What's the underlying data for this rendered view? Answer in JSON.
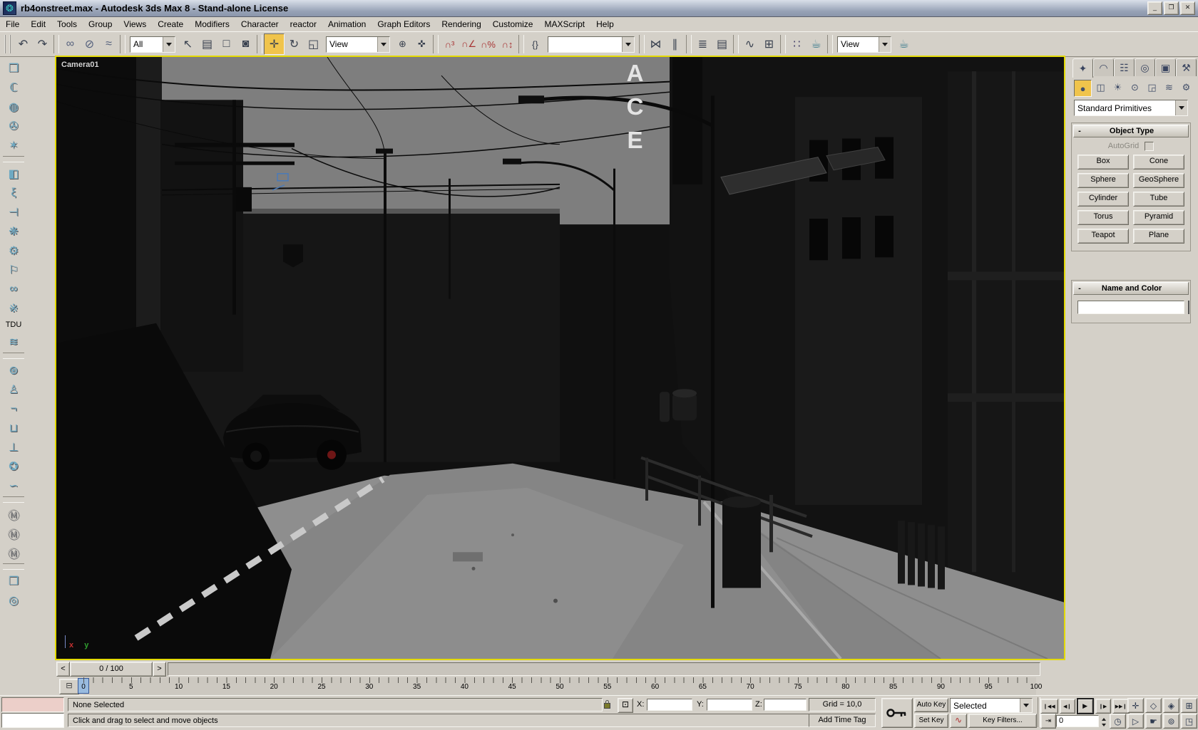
{
  "window": {
    "title": "rb4onstreet.max - Autodesk 3ds Max 8  - Stand-alone License",
    "icon_glyph": "❂",
    "controls": [
      {
        "name": "minimize-button",
        "glyph": "_"
      },
      {
        "name": "maximize-button",
        "glyph": "❐"
      },
      {
        "name": "close-button",
        "glyph": "✕"
      }
    ]
  },
  "menu": {
    "items": [
      "File",
      "Edit",
      "Tools",
      "Group",
      "Views",
      "Create",
      "Modifiers",
      "Character",
      "reactor",
      "Animation",
      "Graph Editors",
      "Rendering",
      "Customize",
      "MAXScript",
      "Help"
    ]
  },
  "toolbar": {
    "seg1": [
      {
        "name": "undo-icon",
        "glyph": "↶"
      },
      {
        "name": "redo-icon",
        "glyph": "↷"
      },
      {
        "kind": "divider"
      },
      {
        "name": "select-and-link-icon",
        "glyph": "∞",
        "color": "#55617d"
      },
      {
        "name": "unlink-selection-icon",
        "glyph": "⊘",
        "color": "#55617d"
      },
      {
        "name": "bind-to-space-warp-icon",
        "glyph": "≈",
        "color": "#55617d"
      },
      {
        "kind": "divider"
      }
    ],
    "selection_filter": {
      "value": "All"
    },
    "seg2": [
      {
        "name": "select-object-icon",
        "glyph": "↖"
      },
      {
        "name": "select-by-name-icon",
        "glyph": "▤"
      },
      {
        "name": "rectangular-selection-region-icon",
        "glyph": "□"
      },
      {
        "name": "window-crossing-toggle-icon",
        "glyph": "◙"
      },
      {
        "kind": "divider"
      },
      {
        "name": "select-and-move-icon",
        "glyph": "✛",
        "active": true
      },
      {
        "name": "select-and-rotate-icon",
        "glyph": "↻"
      },
      {
        "name": "select-and-scale-icon",
        "glyph": "◱"
      }
    ],
    "reference_coordinate": {
      "value": "View"
    },
    "seg3": [
      {
        "name": "use-pivot-center-icon",
        "glyph": "⊕"
      },
      {
        "name": "select-and-manipulate-icon",
        "glyph": "✜"
      },
      {
        "kind": "divider"
      },
      {
        "name": "snap-toggle-3d-icon",
        "glyph": "∩³",
        "color": "#a83434"
      },
      {
        "name": "angle-snap-icon",
        "glyph": "∩∠",
        "color": "#a83434"
      },
      {
        "name": "percent-snap-icon",
        "glyph": "∩%",
        "color": "#a83434"
      },
      {
        "name": "spinner-snap-icon",
        "glyph": "∩↕",
        "color": "#a83434"
      },
      {
        "kind": "divider"
      },
      {
        "name": "edit-named-selection-sets-icon",
        "glyph": "{}"
      }
    ],
    "named_selection": {
      "value": ""
    },
    "seg4": [
      {
        "kind": "divider"
      },
      {
        "name": "mirror-icon",
        "glyph": "⋈"
      },
      {
        "name": "align-icon",
        "glyph": "∥"
      },
      {
        "kind": "divider"
      },
      {
        "name": "layer-manager-icon",
        "glyph": "≣"
      },
      {
        "name": "layer-list-icon",
        "glyph": "▤"
      },
      {
        "kind": "divider"
      },
      {
        "name": "curve-editor-icon",
        "glyph": "∿"
      },
      {
        "name": "schematic-view-icon",
        "glyph": "⊞"
      },
      {
        "kind": "divider"
      },
      {
        "name": "material-editor-icon",
        "glyph": "∷",
        "color": "#44406a"
      },
      {
        "name": "render-scene-icon",
        "glyph": "☕",
        "color": "#3d7e8e"
      },
      {
        "kind": "divider"
      }
    ],
    "render_type": {
      "value": "View"
    },
    "seg5": [
      {
        "name": "quick-render-icon",
        "glyph": "☕",
        "color": "#3d7e8e"
      }
    ]
  },
  "left_toolbar": {
    "items": [
      {
        "name": "rigid-body-collection-icon",
        "glyph": "❒"
      },
      {
        "name": "cloth-collection-icon",
        "glyph": "ℂ"
      },
      {
        "name": "soft-body-collection-icon",
        "glyph": "◍"
      },
      {
        "name": "rope-collection-icon",
        "glyph": "✇"
      },
      {
        "name": "deforming-mesh-collection-icon",
        "glyph": "✶"
      },
      {
        "kind": "divider"
      },
      {
        "name": "plane-icon",
        "glyph": "◧"
      },
      {
        "name": "spring-icon",
        "glyph": "ξ"
      },
      {
        "name": "damper-icon",
        "glyph": "⊣"
      },
      {
        "name": "motor-icon",
        "glyph": "❋"
      },
      {
        "name": "gear-icon",
        "glyph": "⚙"
      },
      {
        "name": "wind-icon",
        "glyph": "⚐"
      },
      {
        "name": "toy-car-icon",
        "glyph": "∞"
      },
      {
        "name": "fracture-icon",
        "glyph": "※"
      },
      {
        "kind": "label",
        "name": "tdu-label",
        "glyph": "TDU"
      },
      {
        "name": "water-icon",
        "glyph": "≋"
      },
      {
        "kind": "divider"
      },
      {
        "name": "constraint-solver-icon",
        "glyph": "⊛"
      },
      {
        "name": "ragdoll-icon",
        "glyph": "♙"
      },
      {
        "name": "hinge-icon",
        "glyph": "¬"
      },
      {
        "name": "point-point-constraint-icon",
        "glyph": "⊔"
      },
      {
        "name": "prismatic-constraint-icon",
        "glyph": "⊥"
      },
      {
        "name": "car-wheel-icon",
        "glyph": "✪"
      },
      {
        "name": "rope-constraint-icon",
        "glyph": "∽"
      },
      {
        "kind": "divider"
      },
      {
        "name": "apply-cloth-modifier-icon",
        "glyph": "Ⓜ",
        "color": "#8f8f8f"
      },
      {
        "name": "apply-soft-body-modifier-icon",
        "glyph": "Ⓜ",
        "color": "#8f8f8f"
      },
      {
        "name": "apply-rope-modifier-icon",
        "glyph": "Ⓜ",
        "color": "#8f8f8f"
      },
      {
        "kind": "divider"
      },
      {
        "name": "property-editor-icon",
        "glyph": "❐"
      },
      {
        "name": "analyze-world-icon",
        "glyph": "◎"
      }
    ]
  },
  "viewport": {
    "camera_label": "Camera01",
    "sign_text": "ACE",
    "axis_x_label": "x",
    "axis_y_label": "y"
  },
  "command_panel": {
    "tabs": [
      {
        "name": "tab-create",
        "glyph": "✦",
        "active": true
      },
      {
        "name": "tab-modify",
        "glyph": "◠"
      },
      {
        "name": "tab-hierarchy",
        "glyph": "☷"
      },
      {
        "name": "tab-motion",
        "glyph": "◎"
      },
      {
        "name": "tab-display",
        "glyph": "▣"
      },
      {
        "name": "tab-utilities",
        "glyph": "⚒"
      }
    ],
    "categories": [
      {
        "name": "category-geometry",
        "glyph": "●",
        "active": true
      },
      {
        "name": "category-shapes",
        "glyph": "◫"
      },
      {
        "name": "category-lights",
        "glyph": "☀"
      },
      {
        "name": "category-cameras",
        "glyph": "⊙"
      },
      {
        "name": "category-helpers",
        "glyph": "◲"
      },
      {
        "name": "category-space-warps",
        "glyph": "≋"
      },
      {
        "name": "category-systems",
        "glyph": "⚙"
      }
    ],
    "subcategory_dropdown": {
      "value": "Standard Primitives"
    },
    "object_type": {
      "collapse_glyph": "-",
      "title": "Object Type",
      "autogrid_label": "AutoGrid",
      "buttons": [
        "Box",
        "Cone",
        "Sphere",
        "GeoSphere",
        "Cylinder",
        "Tube",
        "Torus",
        "Pyramid",
        "Teapot",
        "Plane"
      ]
    },
    "name_and_color": {
      "collapse_glyph": "-",
      "title": "Name and Color",
      "name_value": "",
      "swatch_color": "#8f1a4d"
    }
  },
  "time_controls": {
    "prev_glyph": "<",
    "slider_label": "0 / 100",
    "next_glyph": ">"
  },
  "track_bar": {
    "tick_labels": [
      "0",
      "5",
      "10",
      "15",
      "20",
      "25",
      "30",
      "35",
      "40",
      "45",
      "50",
      "55",
      "60",
      "65",
      "70",
      "75",
      "80",
      "85",
      "90",
      "95",
      "100"
    ],
    "current_frame": "0"
  },
  "status_bar": {
    "selection_status": "None Selected",
    "prompt": "Click and drag to select and move objects",
    "absolute_mode_glyph": "⊡",
    "x_label": "X:",
    "y_label": "Y:",
    "z_label": "Z:",
    "x_value": "",
    "y_value": "",
    "z_value": "",
    "grid_label": "Grid = 10,0",
    "add_time_tag_label": "Add Time Tag"
  },
  "animation": {
    "auto_key_label": "Auto Key",
    "set_key_label": "Set Key",
    "selection_set_value": "Selected",
    "key_filters_label": "Key Filters...",
    "curve_glyph": "∿",
    "frame_value": "0"
  },
  "playback": {
    "row1": [
      {
        "name": "go-to-start-button",
        "glyph": "❙◀◀"
      },
      {
        "name": "previous-frame-button",
        "glyph": "◀❙"
      },
      {
        "name": "play-button",
        "glyph": "▶",
        "kind": "play"
      },
      {
        "name": "next-frame-button",
        "glyph": "❙▶"
      },
      {
        "name": "go-to-end-button",
        "glyph": "▶▶❙"
      }
    ],
    "nav1": [
      {
        "name": "zoom-icon",
        "glyph": "✛"
      },
      {
        "name": "zoom-all-icon",
        "glyph": "◇"
      },
      {
        "name": "zoom-extents-icon",
        "glyph": "◈"
      },
      {
        "name": "zoom-extents-all-icon",
        "glyph": "⊞"
      }
    ],
    "row2": [
      {
        "name": "key-mode-toggle-button",
        "glyph": "⇥"
      }
    ],
    "nav2": [
      {
        "name": "field-of-view-icon",
        "glyph": "▷"
      },
      {
        "name": "pan-icon",
        "glyph": "☛"
      },
      {
        "name": "arc-rotate-icon",
        "glyph": "⊚"
      },
      {
        "name": "min-max-toggle-icon",
        "glyph": "◳"
      }
    ]
  },
  "colors": {
    "ui_gray": "#d4d0c8",
    "active_tool_yellow": "#f0c44c",
    "viewport_border_yellow": "#e3da00",
    "object_color_swatch": "#8f1a4d",
    "timeline_highlight_blue": "#99bbdf"
  }
}
